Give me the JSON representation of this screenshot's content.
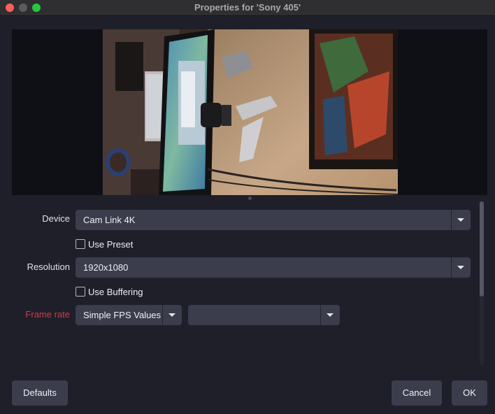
{
  "window": {
    "title": "Properties for 'Sony 405'"
  },
  "form": {
    "device": {
      "label": "Device",
      "value": "Cam Link 4K"
    },
    "use_preset": {
      "label": "Use Preset",
      "checked": false
    },
    "resolution": {
      "label": "Resolution",
      "value": "1920x1080"
    },
    "use_buffering": {
      "label": "Use Buffering",
      "checked": false
    },
    "frame_rate": {
      "label": "Frame rate",
      "mode": "Simple FPS Values",
      "value": "",
      "label_color": "#d33a4c"
    }
  },
  "buttons": {
    "defaults": "Defaults",
    "cancel": "Cancel",
    "ok": "OK"
  },
  "icons": {
    "close": "close-traffic-light",
    "minimize": "minimize-traffic-light",
    "maximize": "maximize-traffic-light",
    "dropdown": "chevron-down-icon"
  }
}
